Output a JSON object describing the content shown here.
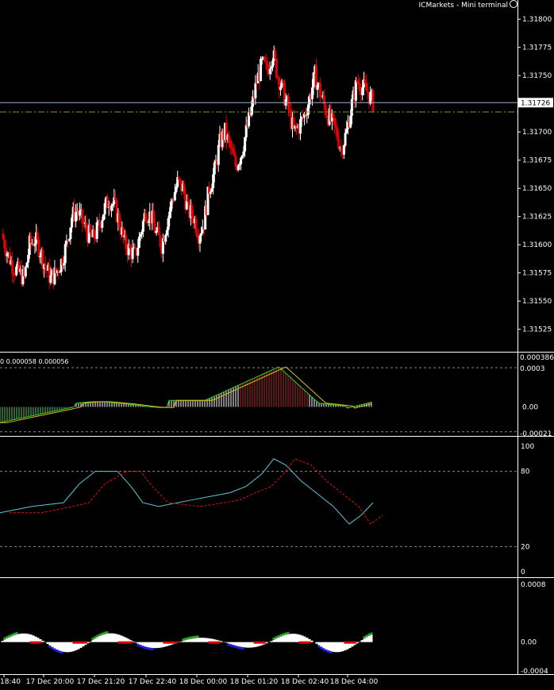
{
  "header": {
    "terminal": "ICMarkets - Mini terminal",
    "smile_icon": "smiley-icon"
  },
  "macd_header": "0 0.000058 0.000056",
  "current_price_label": "1.31726",
  "price_axis": [
    "1.31800",
    "1.31775",
    "1.31750",
    "1.31700",
    "1.31675",
    "1.31650",
    "1.31625",
    "1.31600",
    "1.31575",
    "1.31550",
    "1.31525"
  ],
  "macd_axis": {
    "top": "0.000386",
    "upper": "0.0003",
    "zero": "0.00",
    "bottom": "-0.00021",
    "bottom_label": "0.0002"
  },
  "stoch_axis": [
    "100",
    "80",
    "20",
    "0"
  ],
  "ind3_axis": [
    "0.0008",
    "0.00",
    "-0.0004"
  ],
  "time_axis": [
    "18:40",
    "17 Dec 20:00",
    "17 Dec 21:20",
    "17 Dec 22:40",
    "18 Dec 00:00",
    "18 Dec 01:20",
    "18 Dec 02:40",
    "18 Dec 04:00"
  ],
  "colors": {
    "bull": "#ffffff",
    "bear": "#e00000",
    "grid": "#ffffff",
    "level": "#6e9e3c",
    "cyan": "#5fc6d6",
    "red_dash": "#e01010",
    "green": "#2aa02a",
    "blue": "#1e1ee0"
  },
  "chart_data": {
    "type": "candlestick",
    "price_range": [
      1.3151,
      1.3181
    ],
    "close_series": [
      1.31605,
      1.3159,
      1.3158,
      1.31575,
      1.3157,
      1.316,
      1.31605,
      1.31595,
      1.3158,
      1.3157,
      1.31575,
      1.31585,
      1.316,
      1.31625,
      1.3163,
      1.3162,
      1.3161,
      1.31605,
      1.31615,
      1.3163,
      1.3164,
      1.31635,
      1.3162,
      1.316,
      1.31595,
      1.3159,
      1.3161,
      1.3163,
      1.31625,
      1.3161,
      1.316,
      1.3162,
      1.3164,
      1.31655,
      1.3165,
      1.3163,
      1.31625,
      1.3161,
      1.3162,
      1.3165,
      1.31665,
      1.3169,
      1.317,
      1.31685,
      1.3167,
      1.3168,
      1.317,
      1.3172,
      1.31745,
      1.3176,
      1.31755,
      1.3177,
      1.3175,
      1.31735,
      1.3172,
      1.317,
      1.31705,
      1.31715,
      1.3173,
      1.3175,
      1.31735,
      1.3172,
      1.3171,
      1.317,
      1.31685,
      1.317,
      1.31725,
      1.31745,
      1.3174,
      1.31735,
      1.31726
    ],
    "current_price": 1.31726,
    "level_price": 1.31722,
    "macd": {
      "range": [
        -0.00021,
        0.000386
      ]
    },
    "stochastic": {
      "range": [
        0,
        100
      ],
      "levels": [
        80,
        20
      ]
    },
    "ind3": {
      "range": [
        -0.0004,
        0.0008
      ]
    }
  }
}
